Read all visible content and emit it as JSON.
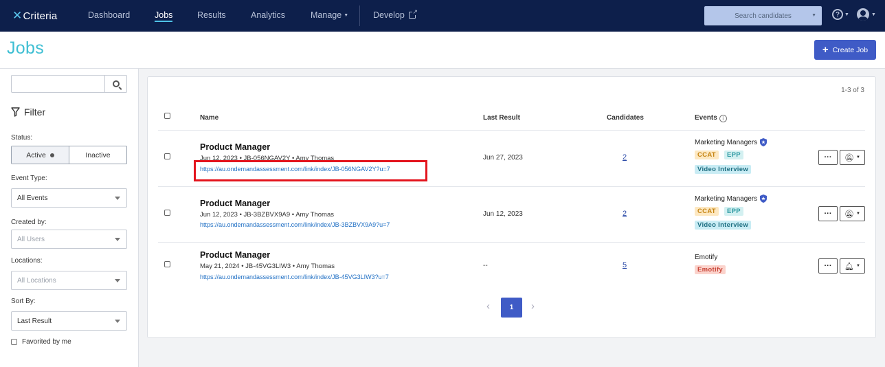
{
  "nav": {
    "logo_text": "Criteria",
    "items": [
      {
        "label": "Dashboard"
      },
      {
        "label": "Jobs"
      },
      {
        "label": "Results"
      },
      {
        "label": "Analytics"
      },
      {
        "label": "Manage"
      },
      {
        "label": "Develop"
      }
    ],
    "search_placeholder": "Search candidates"
  },
  "header": {
    "title": "Jobs",
    "create_label": "Create Job"
  },
  "sidebar": {
    "filter_label": "Filter",
    "status_label": "Status:",
    "status_active": "Active",
    "status_inactive": "Inactive",
    "event_type_label": "Event Type:",
    "event_type_value": "All Events",
    "created_by_label": "Created by:",
    "created_by_value": "All Users",
    "locations_label": "Locations:",
    "locations_value": "All Locations",
    "sort_by_label": "Sort By:",
    "sort_by_value": "Last Result",
    "favorited_label": "Favorited by me"
  },
  "table": {
    "count_text": "1-3 of 3",
    "headers": {
      "name": "Name",
      "last_result": "Last Result",
      "candidates": "Candidates",
      "events": "Events"
    },
    "rows": [
      {
        "title": "Product Manager",
        "meta": "Jun 12, 2023 • JB-056NGAV2Y • Amy Thomas",
        "link": "https://au.ondemandassessment.com/link/index/JB-056NGAV2Y?u=7",
        "last_result": "Jun 27, 2023",
        "candidates": "2",
        "event_name": "Marketing Managers",
        "badges": [
          "CCAT",
          "EPP",
          "Video Interview"
        ]
      },
      {
        "title": "Product Manager",
        "meta": "Jun 12, 2023 • JB-3BZBVX9A9 • Amy Thomas",
        "link": "https://au.ondemandassessment.com/link/index/JB-3BZBVX9A9?u=7",
        "last_result": "Jun 12, 2023",
        "candidates": "2",
        "event_name": "Marketing Managers",
        "badges": [
          "CCAT",
          "EPP",
          "Video Interview"
        ]
      },
      {
        "title": "Product Manager",
        "meta": "May 21, 2024 • JB-45VG3LIW3 • Amy Thomas",
        "link": "https://au.ondemandassessment.com/link/index/JB-45VG3LIW3?u=7",
        "last_result": "--",
        "candidates": "5",
        "event_name": "Emotify",
        "badges": [
          "Emotify"
        ]
      }
    ]
  },
  "pager": {
    "current": "1",
    "prev": "‹",
    "next": "›"
  },
  "colors": {
    "nav_bg": "#0d1f4b",
    "accent": "#3f5bc6",
    "title": "#3fbfd3",
    "highlight": "#e3141d"
  }
}
